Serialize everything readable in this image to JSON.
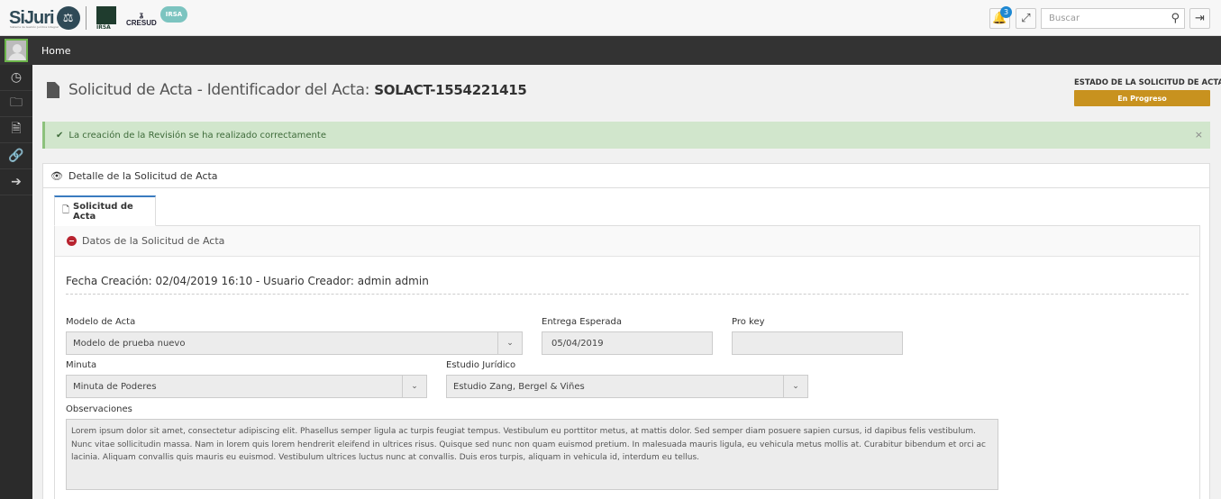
{
  "header": {
    "logo_sijuri": "SiJuri",
    "logo_sijuri_sub": "Sistema de Gestión Jurídica Integral",
    "logo_irsa": "IRSA",
    "logo_cresud": "CRESUD",
    "logo_irsa2": "IRSA",
    "notification_count": "3",
    "search_placeholder": "Buscar"
  },
  "nav": {
    "home": "Home"
  },
  "sidebar_icons": [
    "dashboard-icon",
    "folder-icon",
    "document-icon",
    "link-icon",
    "arrow-right-icon"
  ],
  "page": {
    "title_prefix": "Solicitud de Acta - Identificador del Acta:",
    "title_id": "SOLACT-1554221415",
    "state_label": "ESTADO DE LA SOLICITUD DE ACTA",
    "state_value": "En Progreso",
    "state_color": "#c8921f"
  },
  "alert": {
    "message": "La creación de la Revisión se ha realizado correctamente",
    "close": "×"
  },
  "panel": {
    "title": "Detalle de la Solicitud de Acta",
    "tab": "Solicitud de Acta",
    "section_title": "Datos de la Solicitud de Acta",
    "meta": "Fecha Creación: 02/04/2019 16:10 - Usuario Creador: admin admin"
  },
  "form": {
    "modelo_label": "Modelo de Acta",
    "modelo_value": "Modelo de prueba nuevo",
    "entrega_label": "Entrega Esperada",
    "entrega_value": "05/04/2019",
    "prokey_label": "Pro key",
    "prokey_value": "",
    "minuta_label": "Minuta",
    "minuta_value": "Minuta de Poderes",
    "estudio_label": "Estudio Jurídico",
    "estudio_value": "Estudio Zang, Bergel & Viñes",
    "obs_label": "Observaciones",
    "obs_value": "Lorem ipsum dolor sit amet, consectetur adipiscing elit. Phasellus semper ligula ac turpis feugiat tempus. Vestibulum eu porttitor metus, at mattis dolor. Sed semper diam posuere sapien cursus, id dapibus felis vestibulum. Nunc vitae sollicitudin massa. Nam in lorem quis lorem hendrerit eleifend in ultrices risus. Quisque sed nunc non quam euismod pretium. In malesuada mauris ligula, eu vehicula metus mollis at. Curabitur bibendum et orci ac lacinia. Aliquam convallis quis mauris eu euismod. Vestibulum ultrices luctus nunc at convallis. Duis eros turpis, aliquam in vehicula id, interdum eu tellus."
  }
}
